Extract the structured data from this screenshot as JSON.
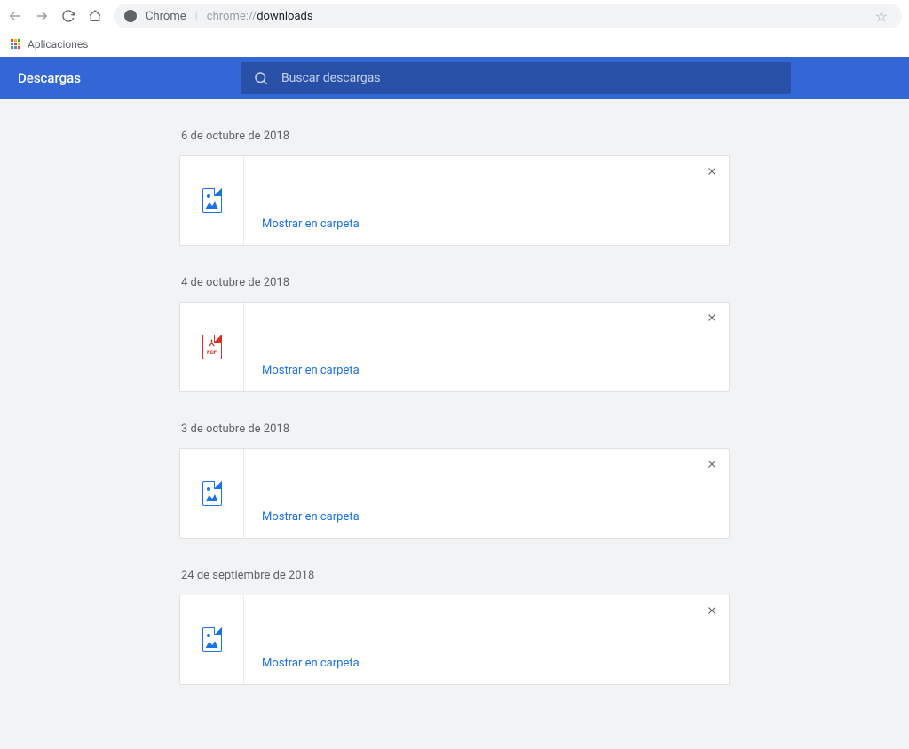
{
  "browser": {
    "address_label": "Chrome",
    "address_url_muted": "chrome://",
    "address_url_strong": "downloads"
  },
  "bookmarks": {
    "apps_label": "Aplicaciones"
  },
  "header": {
    "title": "Descargas",
    "search_placeholder": "Buscar descargas"
  },
  "groups": [
    {
      "date": "6 de octubre de 2018",
      "file_type": "image",
      "show_in_folder": "Mostrar en carpeta"
    },
    {
      "date": "4 de octubre de 2018",
      "file_type": "pdf",
      "show_in_folder": "Mostrar en carpeta"
    },
    {
      "date": "3 de octubre de 2018",
      "file_type": "image",
      "show_in_folder": "Mostrar en carpeta"
    },
    {
      "date": "24 de septiembre de 2018",
      "file_type": "image",
      "show_in_folder": "Mostrar en carpeta"
    }
  ]
}
